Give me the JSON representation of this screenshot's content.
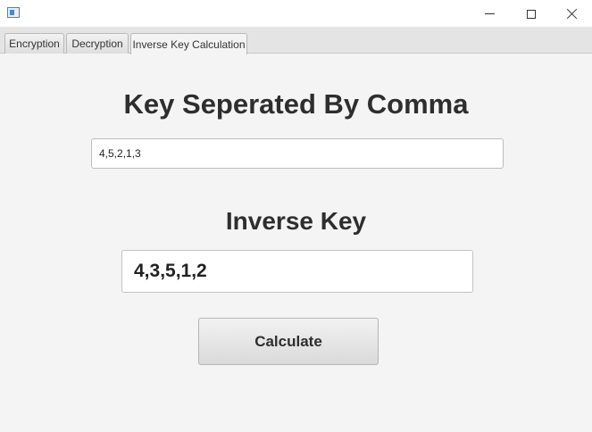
{
  "window": {
    "controls": {
      "minimize_icon": "minimize-icon",
      "maximize_icon": "maximize-icon",
      "close_icon": "close-icon"
    }
  },
  "tabs": [
    {
      "label": "Encryption",
      "active": false
    },
    {
      "label": "Decryption",
      "active": false
    },
    {
      "label": "Inverse Key Calculation",
      "active": true
    }
  ],
  "main": {
    "key_heading": "Key Seperated By Comma",
    "key_input_value": "4,5,2,1,3",
    "inverse_heading": "Inverse Key",
    "inverse_value": "4,3,5,1,2",
    "calculate_label": "Calculate"
  }
}
